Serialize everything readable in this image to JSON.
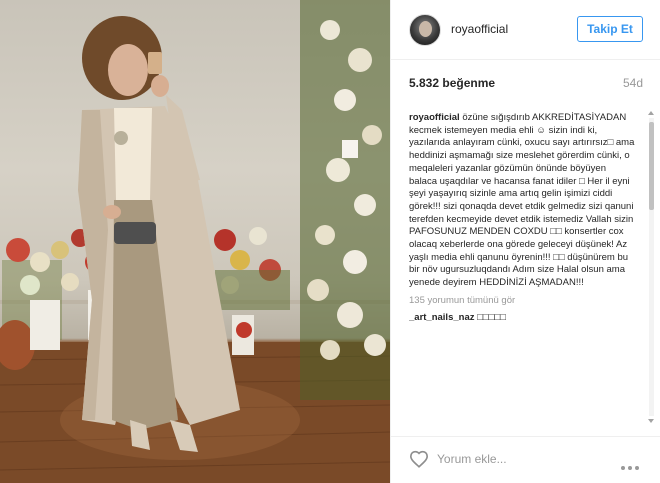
{
  "header": {
    "username": "royaofficial",
    "follow_label": "Takip Et"
  },
  "post": {
    "likes": "5.832 beğenme",
    "time_ago": "54d",
    "caption_user": "royaofficial",
    "caption_text": "özüne sığışdırıb AKKREDİTASİYADAN kecmek istemeyen media ehli ☺ sizin indi ki, yazılarıda anlayıram cünki, oxucu sayı artırırsız□ ama heddinizi aşmamağı size meslehet görerdim cünki, o meqaleleri yazanlar gözümün önünde böyüyen balaca uşaqdılar ve hacansa fanat idiler □ Her il eyni şeyi yaşayırıq sizinle ama artıq gelin işimizi ciddi görek!!! sizi qonaqda devet etdik gelmediz sizi qanuni terefden kecmeyide devet etdik istemediz Vallah sizin PAFOSUNUZ MENDEN COXDU □□ konsertler cox olacaq xeberlerde ona görede geleceyi düşünek! Az yaşlı media ehli qanunu öyrenin!!! □□ düşünürem bu bir növ ugursuzluqdandı Adım size Halal olsun ama yenede deyirem HEDDİNİZİ AŞMADAN!!!",
    "view_all_comments": "135 yorumun tümünü gör",
    "first_comment_user": "_art_nails_naz",
    "first_comment_text": "□□□□□"
  },
  "footer": {
    "comment_placeholder": "Yorum ekle...",
    "like_icon": "heart-outline-icon",
    "more_icon": "more-options-icon"
  },
  "colors": {
    "accent": "#3897f0",
    "text": "#262626",
    "muted": "#999999",
    "divider": "#efefef"
  }
}
